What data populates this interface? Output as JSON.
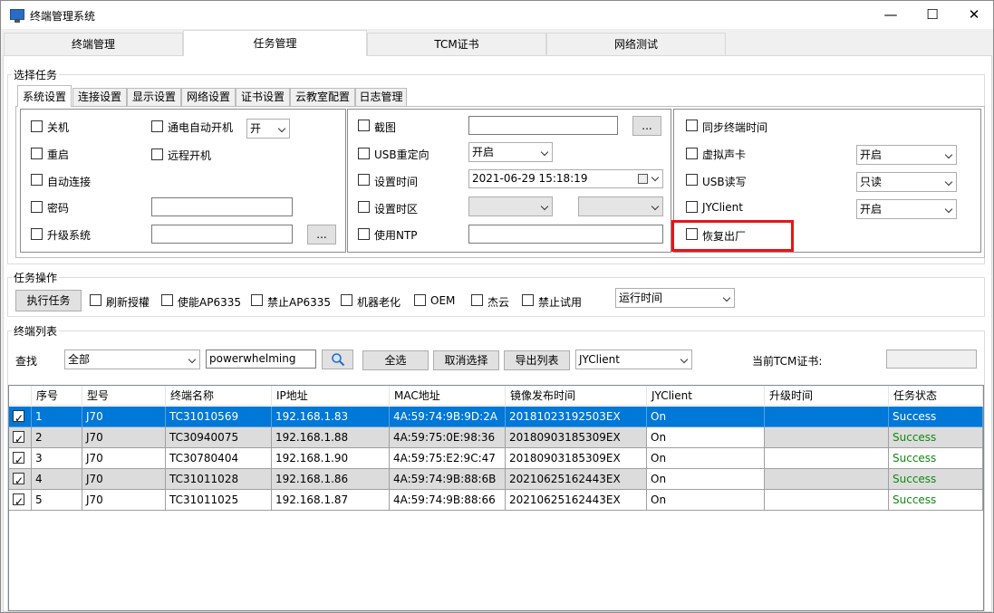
{
  "window": {
    "title": "终端管理系统"
  },
  "main_tabs": [
    "终端管理",
    "任务管理",
    "TCM证书",
    "网络测试"
  ],
  "select_task": {
    "group_label": "选择任务",
    "sub_tabs": [
      "系统设置",
      "连接设置",
      "显示设置",
      "网络设置",
      "证书设置",
      "云教室配置",
      "日志管理"
    ],
    "left": {
      "shutdown": "关机",
      "power_on_auto": "通电自动开机",
      "power_on_auto_value": "开",
      "restart": "重启",
      "remote_boot": "远程开机",
      "auto_connect": "自动连接",
      "password": "密码",
      "password_value": "",
      "upgrade": "升级系统",
      "upgrade_path": "",
      "browse": "..."
    },
    "middle": {
      "screenshot": "截图",
      "screenshot_path": "",
      "browse": "...",
      "usb_redirect": "USB重定向",
      "usb_redirect_value": "开启",
      "set_time": "设置时间",
      "time_value": "2021-06-29  15:18:19",
      "set_timezone": "设置时区",
      "use_ntp": "使用NTP",
      "ntp_value": ""
    },
    "right": {
      "sync_time": "同步终端时间",
      "virtual_sound": "虚拟声卡",
      "virtual_sound_value": "开启",
      "usb_rw": "USB读写",
      "usb_rw_value": "只读",
      "jyclient": "JYClient",
      "jyclient_value": "开启",
      "factory_reset": "恢复出厂"
    }
  },
  "task_ops": {
    "group_label": "任务操作",
    "execute": "执行任务",
    "refresh_auth": "刷新授權",
    "enable_ap": "使能AP6335",
    "disable_ap": "禁止AP6335",
    "aging": "机器老化",
    "oem": "OEM",
    "jieyun": "杰云",
    "no_trial": "禁止试用",
    "runtime": "运行时间"
  },
  "terminal_list": {
    "group_label": "终端列表",
    "search_label": "查找",
    "filter_value": "全部",
    "search_value": "powerwhelming",
    "select_all": "全选",
    "deselect": "取消选择",
    "export": "导出列表",
    "client_value": "JYClient",
    "tcm_label": "当前TCM证书:",
    "tcm_value": "",
    "columns": [
      "序号",
      "型号",
      "终端名称",
      "IP地址",
      "MAC地址",
      "镜像发布时间",
      "JYClient",
      "升级时间",
      "任务状态"
    ],
    "rows": [
      [
        "1",
        "J70",
        "TC31010569",
        "192.168.1.83",
        "4A:59:74:9B:9D:2A",
        "20181023192503EX",
        "On",
        "",
        "Success"
      ],
      [
        "2",
        "J70",
        "TC30940075",
        "192.168.1.88",
        "4A:59:75:0E:98:36",
        "20180903185309EX",
        "On",
        "",
        "Success"
      ],
      [
        "3",
        "J70",
        "TC30780404",
        "192.168.1.90",
        "4A:59:75:E2:9C:47",
        "20180903185309EX",
        "On",
        "",
        "Success"
      ],
      [
        "4",
        "J70",
        "TC31011028",
        "192.168.1.86",
        "4A:59:74:9B:88:6B",
        "20210625162443EX",
        "On",
        "",
        "Success"
      ],
      [
        "5",
        "J70",
        "TC31011025",
        "192.168.1.87",
        "4A:59:74:9B:88:66",
        "20210625162443EX",
        "On",
        "",
        "Success"
      ]
    ]
  }
}
